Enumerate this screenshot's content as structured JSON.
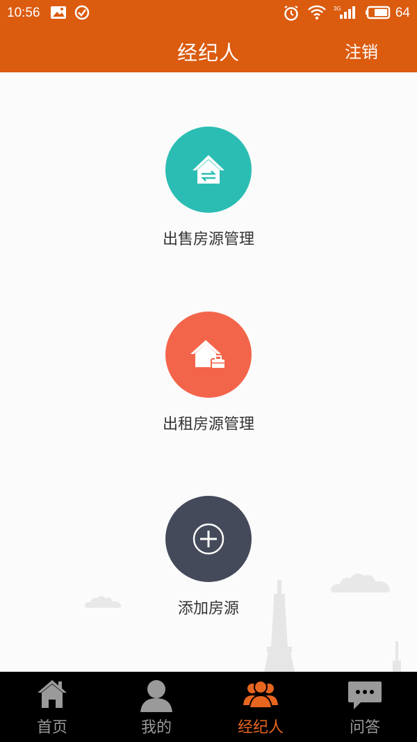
{
  "status_bar": {
    "time": "10:56",
    "battery": "64",
    "icons": [
      "image-icon",
      "check-circle-icon",
      "alarm-icon",
      "wifi-icon",
      "signal-3g-icon",
      "battery-icon"
    ]
  },
  "header": {
    "title": "经纪人",
    "logout_label": "注销"
  },
  "actions": [
    {
      "label": "出售房源管理",
      "icon": "house-exchange-icon",
      "color": "#2bbdb3"
    },
    {
      "label": "出租房源管理",
      "icon": "house-briefcase-icon",
      "color": "#f3654a"
    },
    {
      "label": "添加房源",
      "icon": "plus-circle-icon",
      "color": "#444a5a"
    }
  ],
  "bottom_nav": {
    "active_index": 2,
    "active_color": "#e8651f",
    "items": [
      {
        "label": "首页",
        "icon": "home-icon"
      },
      {
        "label": "我的",
        "icon": "user-icon"
      },
      {
        "label": "经纪人",
        "icon": "group-icon"
      },
      {
        "label": "问答",
        "icon": "chat-icon"
      }
    ]
  },
  "colors": {
    "brand": "#db5b0f",
    "nav_background": "#000000"
  }
}
